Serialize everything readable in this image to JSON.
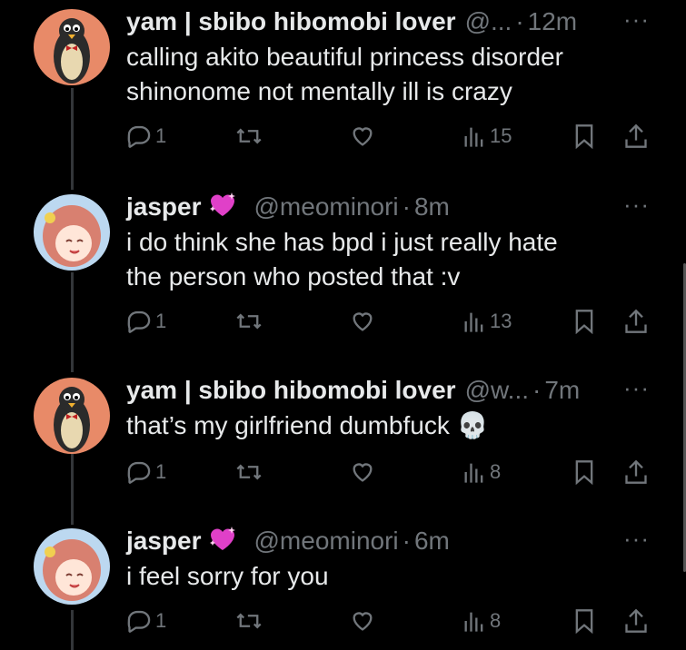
{
  "tweets": [
    {
      "name": "yam | sbibo hibomobi lover",
      "handle": "@...",
      "time": "12m",
      "text_lines": [
        "calling akito beautiful princess disorder",
        "shinonome not mentally ill is crazy"
      ],
      "replies": "1",
      "views": "15",
      "avatar": "penguin-avatar",
      "verified_emoji": ""
    },
    {
      "name": "jasper",
      "handle": "@meominori",
      "time": "8m",
      "text_lines": [
        "i do think she has bpd i just really hate",
        "the person who posted that :v"
      ],
      "replies": "1",
      "views": "13",
      "avatar": "anime-girl-avatar",
      "verified_emoji": "sparkling-heart"
    },
    {
      "name": "yam | sbibo hibomobi lover",
      "handle": "@w...",
      "time": "7m",
      "text_lines": [
        "that’s my girlfriend dumbfuck 💀"
      ],
      "replies": "1",
      "views": "8",
      "avatar": "penguin-avatar",
      "verified_emoji": ""
    },
    {
      "name": "jasper",
      "handle": "@meominori",
      "time": "6m",
      "text_lines": [
        "i feel sorry for you"
      ],
      "replies": "1",
      "views": "8",
      "avatar": "anime-girl-avatar",
      "verified_emoji": "sparkling-heart"
    }
  ],
  "ui": {
    "more_glyph": "···",
    "dot": "·"
  },
  "colors": {
    "background": "#000000",
    "text": "#e7e9ea",
    "muted": "#71767b",
    "heart": "#e040c8"
  }
}
